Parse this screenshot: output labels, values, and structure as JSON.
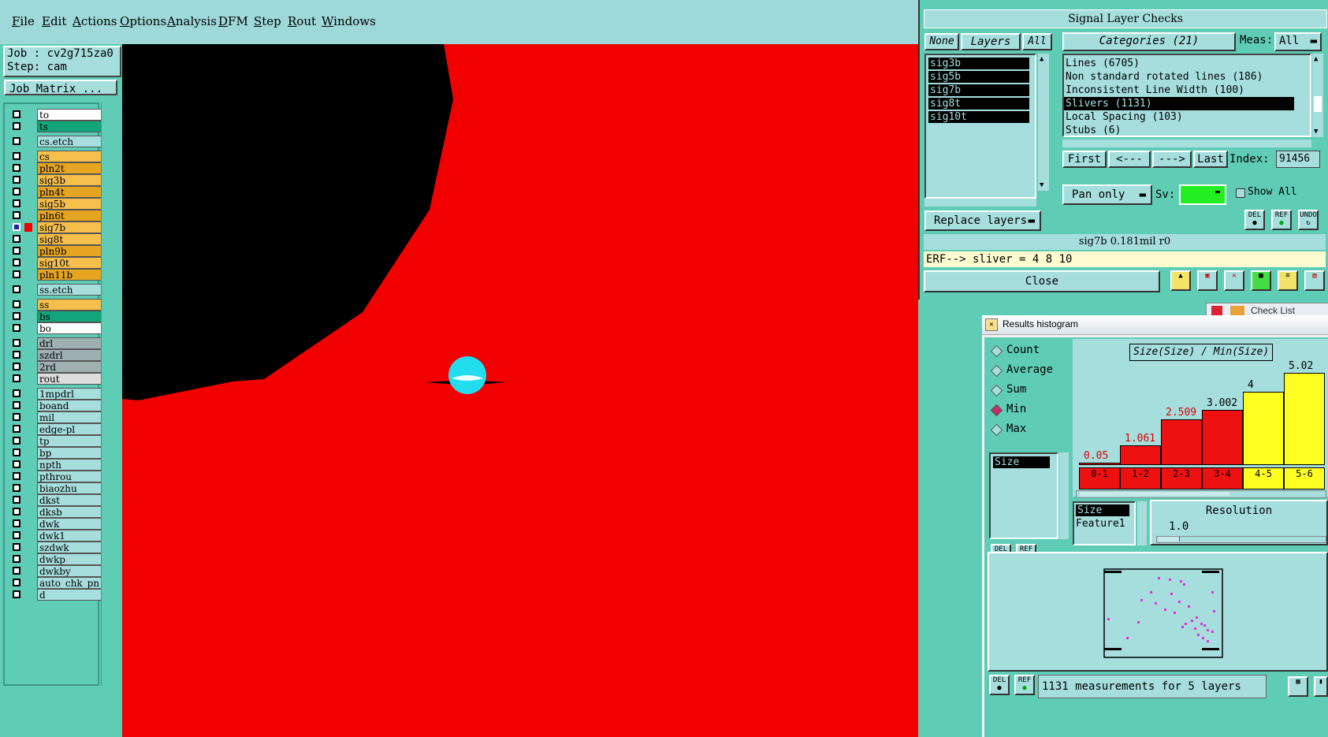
{
  "menubar": {
    "items": [
      "File",
      "Edit",
      "Actions",
      "Options",
      "Analysis",
      "DFM",
      "Step",
      "Rout",
      "Windows"
    ]
  },
  "job": {
    "job_label": "Job : cv2g715za0",
    "step_label": "Step: cam",
    "matrix_button": "Job Matrix ..."
  },
  "layers": [
    {
      "name": "to",
      "color": "#ffffff"
    },
    {
      "name": "ts",
      "color": "#12a57a"
    },
    {
      "name": "cs.etch",
      "color": "#a6dede"
    },
    {
      "name": "cs",
      "color": "#f6bf4c"
    },
    {
      "name": "pln2t",
      "color": "#e6a520"
    },
    {
      "name": "sig3b",
      "color": "#f6bf4c"
    },
    {
      "name": "pln4t",
      "color": "#e6a520"
    },
    {
      "name": "sig5b",
      "color": "#f6bf4c"
    },
    {
      "name": "pln6t",
      "color": "#e6a520"
    },
    {
      "name": "sig7b",
      "color": "#f6bf4c"
    },
    {
      "name": "sig8t",
      "color": "#f6bf4c"
    },
    {
      "name": "pln9b",
      "color": "#e6a520"
    },
    {
      "name": "sig10t",
      "color": "#f6bf4c"
    },
    {
      "name": "pln11b",
      "color": "#e6a520"
    },
    {
      "name": "ss.etch",
      "color": "#a6dede"
    },
    {
      "name": "ss",
      "color": "#f6bf4c"
    },
    {
      "name": "bs",
      "color": "#12a57a"
    },
    {
      "name": "bo",
      "color": "#ffffff"
    },
    {
      "name": "drl",
      "color": "#9fb0b0"
    },
    {
      "name": "szdrl",
      "color": "#9fb0b0"
    },
    {
      "name": "2rd",
      "color": "#9fb0b0"
    },
    {
      "name": "rout",
      "color": "#dcdcdc"
    },
    {
      "name": "1mpdrl",
      "color": "#a6dede"
    },
    {
      "name": "boand",
      "color": "#a6dede"
    },
    {
      "name": "mil",
      "color": "#a6dede"
    },
    {
      "name": "edge-pl",
      "color": "#a6dede"
    },
    {
      "name": "tp",
      "color": "#a6dede"
    },
    {
      "name": "bp",
      "color": "#a6dede"
    },
    {
      "name": "npth",
      "color": "#a6dede"
    },
    {
      "name": "pthrou",
      "color": "#a6dede"
    },
    {
      "name": "biaozhu",
      "color": "#a6dede"
    },
    {
      "name": "dkst",
      "color": "#a6dede"
    },
    {
      "name": "dksb",
      "color": "#a6dede"
    },
    {
      "name": "dwk",
      "color": "#a6dede"
    },
    {
      "name": "dwk1",
      "color": "#a6dede"
    },
    {
      "name": "szdwk",
      "color": "#a6dede"
    },
    {
      "name": "dwkp",
      "color": "#a6dede"
    },
    {
      "name": "dwkby",
      "color": "#a6dede"
    },
    {
      "name": "auto_chk_pn",
      "color": "#a6dede"
    },
    {
      "name": "d",
      "color": "#a6dede"
    }
  ],
  "signal": {
    "title": "Signal Layer Checks",
    "none_btn": "None",
    "layers_btn": "Layers",
    "all_btn": "All",
    "categories_title": "Categories (21)",
    "meas_label": "Meas:",
    "meas_value": "All",
    "layer_list": [
      "sig3b",
      "sig5b",
      "sig7b",
      "sig8t",
      "sig10t"
    ],
    "categories": [
      "Lines (6705)",
      "Non standard rotated lines (186)",
      "Inconsistent Line Width (100)",
      "Slivers (1131)",
      "Local Spacing (103)",
      "Stubs (6)"
    ],
    "selected_category": 3,
    "first_btn": "First",
    "prev_btn": "<---",
    "next_btn": "--->",
    "last_btn": "Last",
    "index_label": "Index:",
    "index_value": "91456",
    "pan_option": "Pan only",
    "sv_label": "Sv:",
    "show_all": "Show All",
    "replace_option": "Replace layers",
    "status": "sig7b 0.181mil  r0",
    "erf": "ERF--> sliver = 4 8 10",
    "close_btn": "Close",
    "del_icon": "DEL",
    "ref_icon": "REF",
    "undo_icon": "UNDO"
  },
  "behind_title": "Check List",
  "histogram": {
    "title": "Results histogram",
    "radios": [
      "Count",
      "Average",
      "Sum",
      "Min",
      "Max"
    ],
    "selected_radio": 3,
    "attr_list": [
      "Size"
    ],
    "chart_title": "Size(Size) / Min(Size)",
    "size_list": [
      "Size",
      "Feature1"
    ],
    "resolution_label": "Resolution",
    "resolution_value": "1.0",
    "footer": "1131 measurements for 5 layers",
    "del_icon": "DEL",
    "ref_icon": "REF"
  },
  "chart_data": {
    "type": "bar",
    "categories": [
      "0-1",
      "1-2",
      "2-3",
      "3-4",
      "4-5",
      "5-6"
    ],
    "values": [
      0.05,
      1.061,
      2.509,
      3.002,
      4,
      5.02
    ],
    "value_labels": [
      "0.05",
      "1.061",
      "2.509",
      "3.002",
      "4",
      "5.02"
    ],
    "bar_colors": [
      "#ee1111",
      "#ee1111",
      "#ee1111",
      "#ee1111",
      "#ffff22",
      "#ffff22"
    ],
    "label_colors": [
      "#dd0000",
      "#dd0000",
      "#dd0000",
      "#000000",
      "#000000",
      "#000000"
    ],
    "ylim": [
      0,
      5.6
    ]
  },
  "colors": {
    "panel": "#5fcdb6",
    "field": "#a6dede",
    "canvas": "#f20000",
    "feature": "#000000",
    "pad": "#22ddee"
  }
}
